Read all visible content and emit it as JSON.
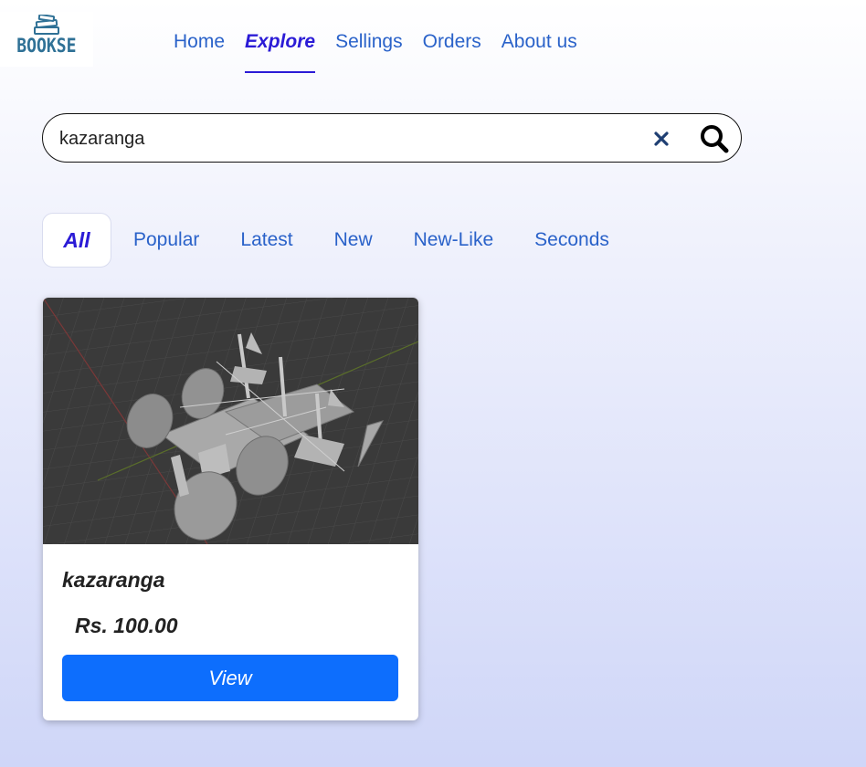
{
  "brand": {
    "name": "BOOKSE",
    "logo_icon": "books-stack-icon"
  },
  "nav": {
    "items": [
      {
        "label": "Home",
        "active": false
      },
      {
        "label": "Explore",
        "active": true
      },
      {
        "label": "Sellings",
        "active": false
      },
      {
        "label": "Orders",
        "active": false
      },
      {
        "label": "About us",
        "active": false
      }
    ]
  },
  "search": {
    "value": "kazaranga",
    "clear_icon": "close-icon",
    "search_icon": "search-icon"
  },
  "filters": {
    "items": [
      {
        "label": "All",
        "active": true
      },
      {
        "label": "Popular",
        "active": false
      },
      {
        "label": "Latest",
        "active": false
      },
      {
        "label": "New",
        "active": false
      },
      {
        "label": "New-Like",
        "active": false
      },
      {
        "label": "Seconds",
        "active": false
      }
    ]
  },
  "products": [
    {
      "title": "kazaranga",
      "price": "Rs. 100.00",
      "button_label": "View",
      "image": "3d-model-vehicle-render"
    }
  ],
  "colors": {
    "nav_link": "#2a62c9",
    "nav_active": "#2b1bd6",
    "button_primary": "#0d6efd",
    "brand": "#2f7196"
  }
}
